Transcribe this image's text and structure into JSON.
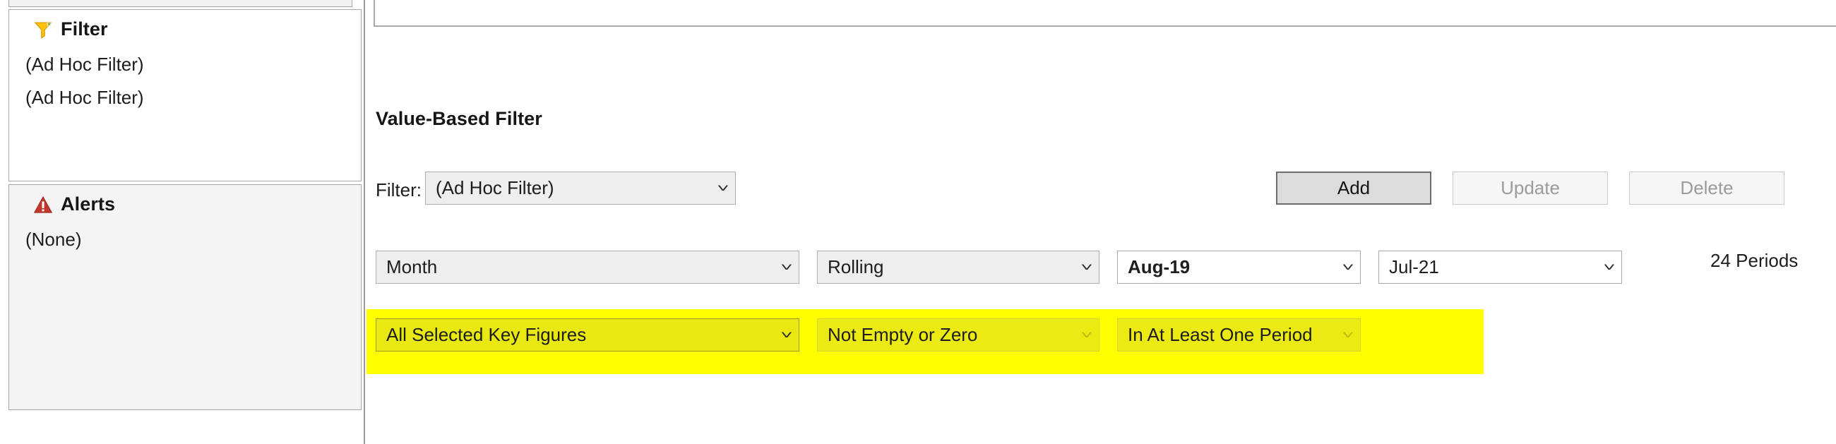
{
  "sidebar": {
    "filter_panel": {
      "title": "Filter",
      "icon": "funnel-icon",
      "items": [
        {
          "label": "(Ad Hoc Filter)"
        },
        {
          "label": "(Ad Hoc Filter)"
        }
      ]
    },
    "alerts_panel": {
      "title": "Alerts",
      "icon": "warning-triangle-icon",
      "items": [
        {
          "label": "(None)"
        }
      ]
    }
  },
  "main": {
    "section_title": "Value-Based Filter",
    "filter_label": "Filter:",
    "filter_select": {
      "value": "(Ad Hoc Filter)",
      "chevron": "˅"
    },
    "buttons": {
      "add": "Add",
      "update": "Update",
      "delete": "Delete"
    },
    "period_row": {
      "granularity": "Month",
      "mode": "Rolling",
      "from": "Aug-19",
      "to": "Jul-21",
      "periods_text": "24 Periods"
    },
    "value_row": {
      "key_figures": "All Selected Key Figures",
      "condition": "Not Empty or Zero",
      "scope": "In At Least One Period"
    }
  },
  "colors": {
    "highlight": "#ffff00",
    "highlight_combo": "#e9e911",
    "panel_border": "#a6a6a6",
    "alerts_panel_bg": "#f4f4f4",
    "funnel_icon": "#ffc20e",
    "alert_icon": "#c0392b"
  }
}
